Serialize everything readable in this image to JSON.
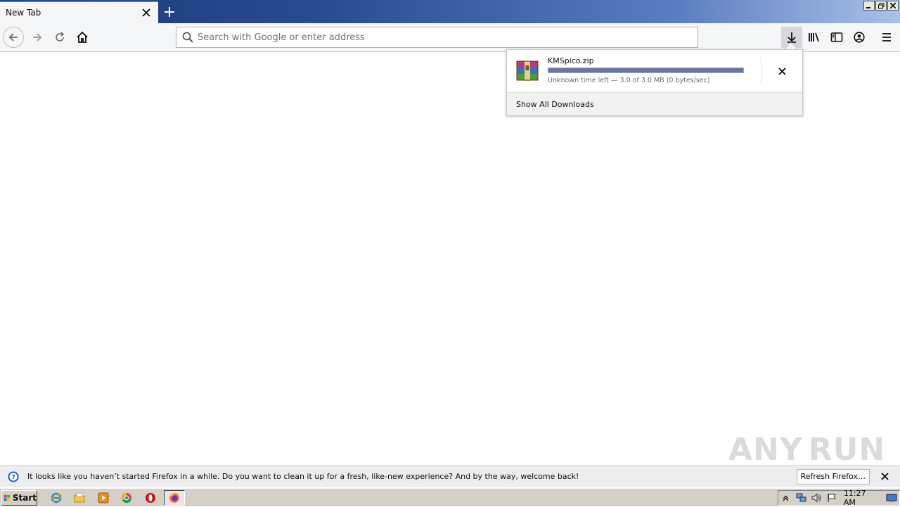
{
  "tab": {
    "title": "New Tab"
  },
  "window_controls": {
    "minimize": "_",
    "restore": "❐",
    "close": "✕"
  },
  "urlbar": {
    "placeholder": "Search with Google or enter address",
    "value": ""
  },
  "downloads": {
    "items": [
      {
        "filename": "KMSpico.zip",
        "status": "Unknown time left — 3.0 of 3.0 MB (0 bytes/sec)",
        "progress_percent": 100
      }
    ],
    "show_all_label": "Show All Downloads"
  },
  "watermark": {
    "left": "ANY",
    "right": "RUN"
  },
  "notification": {
    "text": "It looks like you haven’t started Firefox in a while. Do you want to clean it up for a fresh, like-new experience? And by the way, welcome back!",
    "button_label": "Refresh Firefox…"
  },
  "taskbar": {
    "start_label": "Start",
    "clock": "11:27 AM"
  },
  "colors": {
    "accent": "#0a84ff",
    "progress": "#6a74a5",
    "titlebar": "#2a4a8e"
  }
}
